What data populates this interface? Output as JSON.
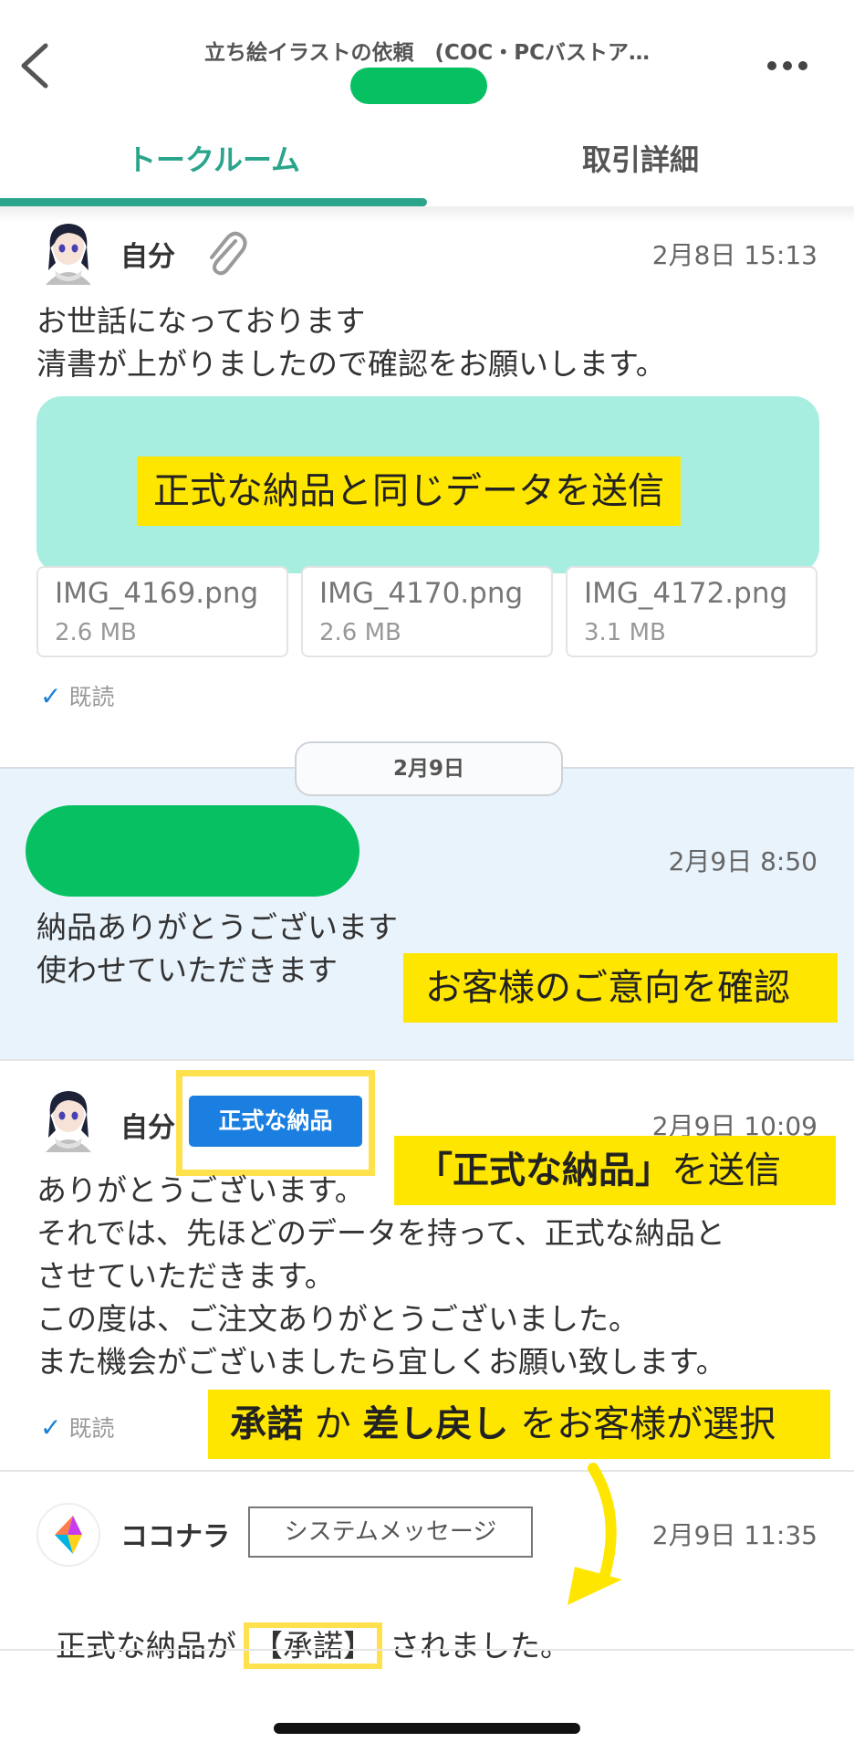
{
  "header": {
    "title": "立ち絵イラストの依頼　(COC・PCバストア…",
    "tabs": [
      "トークルーム",
      "取引詳細"
    ]
  },
  "messages": [
    {
      "sender": "自分",
      "time": "2月8日 15:13",
      "text": "お世話になっております\n清書が上がりましたので確認をお願いします。",
      "files": [
        {
          "name": "IMG_4169.png",
          "size": "2.6 MB"
        },
        {
          "name": "IMG_4170.png",
          "size": "2.6 MB"
        },
        {
          "name": "IMG_4172.png",
          "size": "3.1 MB"
        }
      ],
      "read": "既読"
    },
    {
      "time": "2月9日 8:50",
      "text": "納品ありがとうございます\n使わせていただきます"
    },
    {
      "sender": "自分",
      "badge": "正式な納品",
      "time": "2月9日 10:09",
      "text": "ありがとうございます。\nそれでは、先ほどのデータを持って、正式な納品と\nさせていただきます。\nこの度は、ご注文ありがとうございました。\nまた機会がございましたら宜しくお願い致します。",
      "read": "既読"
    },
    {
      "sender": "ココナラ",
      "badge": "システムメッセージ",
      "time": "2月9日 11:35",
      "text_before": "正式な納品が",
      "text_highlight": "【承諾】",
      "text_after": "されました。"
    }
  ],
  "date_separator": "2月9日",
  "annotations": {
    "send_same_data": "正式な納品と同じデータを送信",
    "confirm_intent": "お客様のご意向を確認",
    "send_official_quote": "「正式な納品」",
    "send_official_rest": "を送信",
    "choose_1": "承諾",
    "choose_2": "か",
    "choose_3": "差し戻し",
    "choose_4": "をお客様が選択"
  },
  "colors": {
    "accent": "#2aa58b",
    "badge_blue": "#1a7fe0",
    "highlight_yellow": "#ffe600",
    "teal_overlay": "#a7eee1",
    "redaction_green": "#06c062"
  }
}
